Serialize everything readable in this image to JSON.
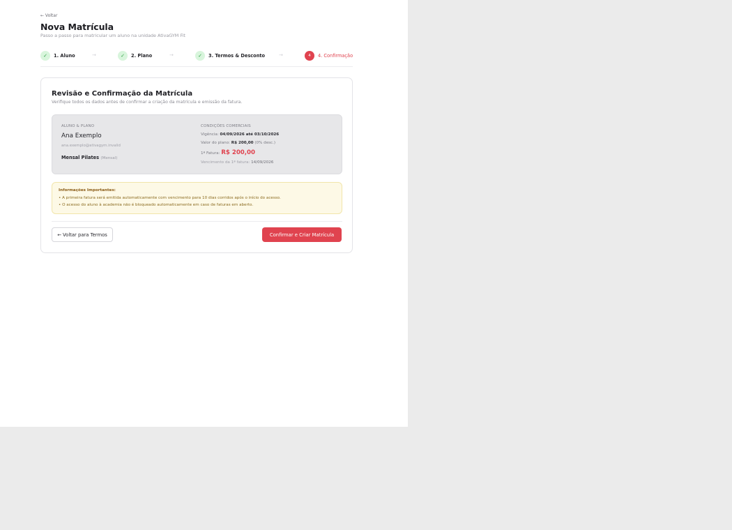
{
  "nav": {
    "back_label": "← Voltar"
  },
  "header": {
    "title": "Nova Matrícula",
    "subtitle": "Passo a passo para matricular um aluno na unidade AtivaGYM Fit"
  },
  "stepper": {
    "steps": [
      {
        "label": "1. Aluno",
        "marker": "✓",
        "state": "done"
      },
      {
        "label": "2. Plano",
        "marker": "✓",
        "state": "done"
      },
      {
        "label": "3. Termos & Desconto",
        "marker": "✓",
        "state": "done"
      },
      {
        "label": "4. Confirmação",
        "marker": "4",
        "state": "active"
      }
    ],
    "separator": "→"
  },
  "card": {
    "title": "Revisão e Confirmação da Matrícula",
    "subtitle": "Verifique todos os dados antes de confirmar a criação da matrícula e emissão da fatura."
  },
  "summary": {
    "student_heading": "ALUNO & PLANO",
    "student_name": "Ana Exemplo",
    "student_email": "ana.exemplo@ativagym.invalid",
    "plan_name": "Mensal Pilates",
    "plan_period": "(Mensal)",
    "commercial_heading": "CONDIÇÕES COMERCIAIS",
    "validity_label": "Vigência:",
    "validity_value": "04/09/2026 até 03/10/2026",
    "plan_value_label": "Valor do plano:",
    "plan_value": "R$ 200,00",
    "plan_discount": "(0% desc.)",
    "first_invoice_label": "1ª Fatura:",
    "first_invoice_value": "R$ 200,00",
    "due_label": "Vencimento da 1ª fatura:",
    "due_value": "14/09/2026"
  },
  "notice": {
    "title": "Informações Importantes:",
    "items": [
      "• A primeira fatura será emitida automaticamente com vencimento para 10 dias corridos após o início do acesso.",
      "• O acesso do aluno à academia não é bloqueado automaticamente em caso de faturas em aberto."
    ]
  },
  "actions": {
    "back_label": "← Voltar para Termos",
    "confirm_label": "Confirmar e Criar Matrícula"
  },
  "colors": {
    "accent": "#e0434f",
    "done": "#2f9e45",
    "done_bg": "#d8f5dc",
    "notice_bg": "#fdf9e6"
  }
}
